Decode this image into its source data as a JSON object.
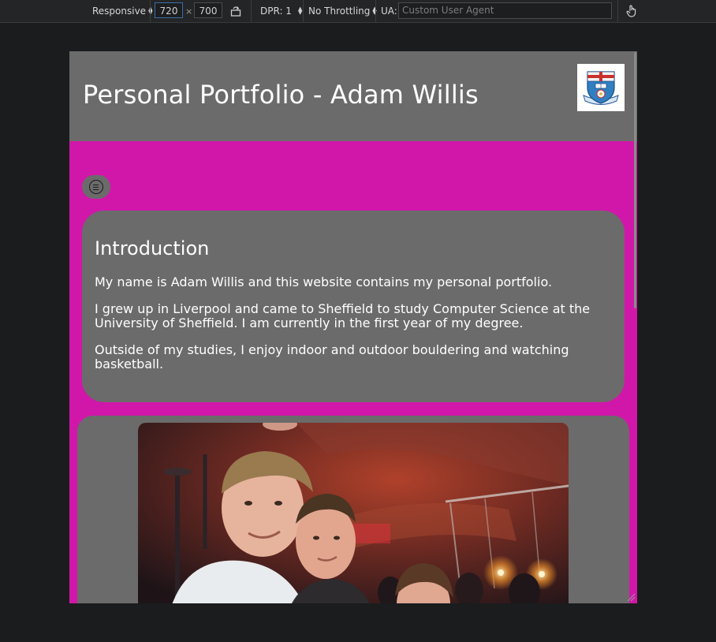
{
  "toolbar": {
    "device": "Responsive",
    "width": "720",
    "height": "700",
    "dimension_separator": "×",
    "dpr": "DPR: 1",
    "throttling": "No Throttling",
    "ua_label": "UA:",
    "ua_placeholder": "Custom User Agent"
  },
  "site": {
    "title": "Personal Portfolio - Adam Willis",
    "logo_icon": "university-crest-icon"
  },
  "nav": {
    "menu_icon": "menu-icon"
  },
  "intro": {
    "heading": "Introduction",
    "paragraphs": [
      "My name is Adam Willis and this website contains my personal portfolio.",
      "I grew up in Liverpool and came to Sheffield to study Computer Science at the University of Sheffield. I am currently in the first year of my degree.",
      "Outside of my studies, I enjoy indoor and outdoor bouldering and watching basketball."
    ]
  },
  "colors": {
    "page_background": "#d117a9",
    "card_background": "#6b6b6b",
    "text": "#ffffff"
  }
}
